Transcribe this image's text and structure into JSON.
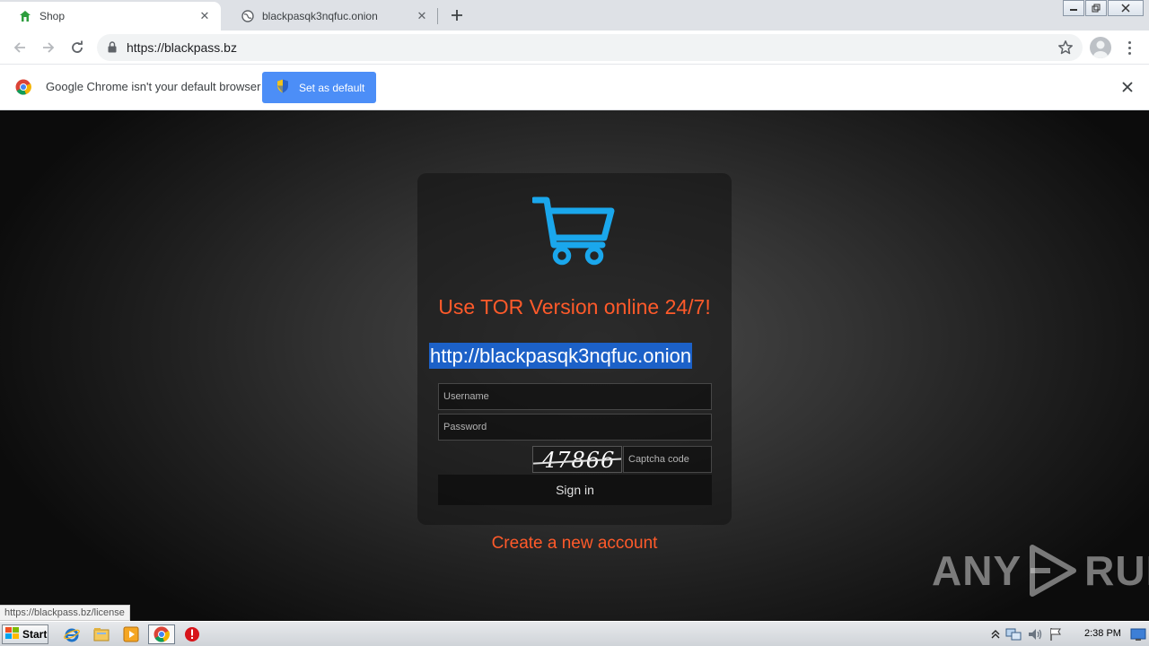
{
  "browser": {
    "tabs": [
      {
        "title": "Shop",
        "active": true
      },
      {
        "title": "blackpasqk3nqfuc.onion",
        "active": false
      }
    ],
    "address": "https://blackpass.bz",
    "status_url": "https://blackpass.bz/license"
  },
  "infobar": {
    "message": "Google Chrome isn't your default browser",
    "button_label": "Set as default"
  },
  "login": {
    "headline": "Use TOR Version online 24/7!",
    "onion_link": "http://blackpasqk3nqfuc.onion",
    "username_placeholder": "Username",
    "password_placeholder": "Password",
    "captcha_value": "47866",
    "captcha_placeholder": "Captcha code",
    "signin_label": "Sign in",
    "create_account_label": "Create a new account",
    "accent_color": "#ff5a2a",
    "icon_color": "#1aa7ec",
    "icon": "shopping-cart-icon"
  },
  "watermark": {
    "left": "ANY",
    "right": "RUN"
  },
  "taskbar": {
    "start_label": "Start",
    "clock": "2:38 PM"
  }
}
